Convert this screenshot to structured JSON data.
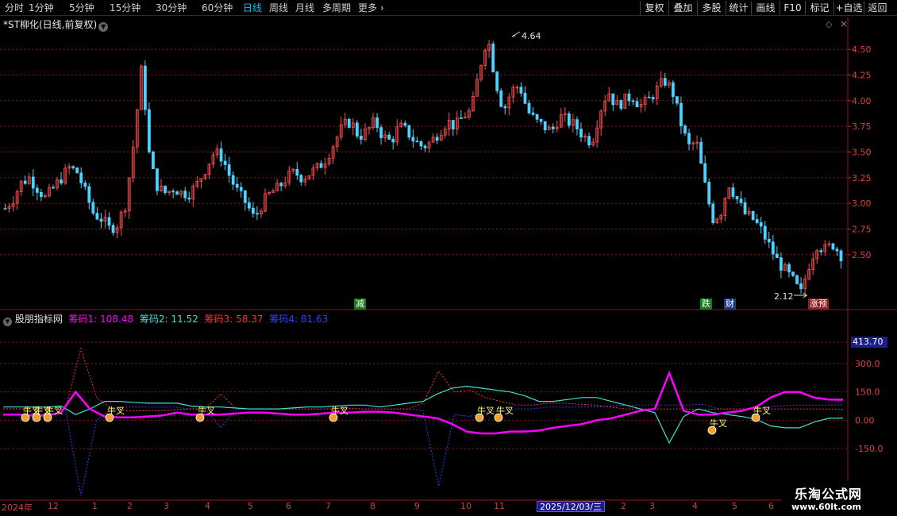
{
  "toolbar": {
    "periods": [
      "分时",
      "1分钟",
      "5分钟",
      "15分钟",
      "30分钟",
      "60分钟",
      "日线",
      "周线",
      "月线",
      "多周期",
      "更多"
    ],
    "active_period": "日线",
    "more_arrow": "›",
    "buttons": [
      "复权",
      "叠加",
      "多股",
      "统计",
      "画线",
      "F10",
      "标记",
      "+自选",
      "返回"
    ]
  },
  "stock": {
    "title": "*ST柳化(日线,前复权)",
    "high_label": "4.64",
    "low_label": "2.12"
  },
  "price_axis": {
    "ticks": [
      "4.50",
      "4.25",
      "4.00",
      "3.75",
      "3.50",
      "3.25",
      "3.00",
      "2.75",
      "2.50"
    ]
  },
  "markers": {
    "jian": "减",
    "die": "跌",
    "cai": "财",
    "zhangyu": "涨预"
  },
  "indicator": {
    "name": "股朋指标网",
    "chip1": "筹码1: 108.48",
    "chip2": "筹码2: 11.52",
    "chip3": "筹码3: 58.37",
    "chip4": "筹码4: 81.63",
    "axis_ticks": [
      "300.0",
      "150.0",
      "0.00",
      "-150.0"
    ],
    "current_value": "413.70",
    "signal_label": "牛叉"
  },
  "time_axis": {
    "year": "2024年",
    "months": [
      "12",
      "1",
      "2",
      "3",
      "4",
      "5",
      "6",
      "7",
      "8",
      "9",
      "10",
      "11",
      "2",
      "3",
      "4",
      "5",
      "6"
    ],
    "cursor_date": "2025/12/03/三"
  },
  "watermark": {
    "line1": "乐淘公式网",
    "line2": "www.60lt.com"
  },
  "colors": {
    "up": "#ff4d4d",
    "down": "#4dd2ff",
    "grid": "#8b1a1a",
    "chip1": "#ff00ff",
    "chip2": "#40e0d0",
    "chip3": "#ff3030",
    "chip4": "#3040ff",
    "active": "#00c8e6"
  },
  "chart_data": {
    "type": "candlestick",
    "title": "*ST柳化(日线,前复权)",
    "ylim": [
      2.12,
      4.64
    ],
    "y_ticks": [
      4.5,
      4.25,
      4.0,
      3.75,
      3.5,
      3.25,
      3.0,
      2.75,
      2.5
    ],
    "price_path": [
      2.95,
      3.05,
      3.2,
      3.25,
      3.15,
      3.05,
      3.15,
      3.25,
      3.35,
      3.3,
      3.1,
      2.9,
      2.85,
      2.75,
      2.8,
      3.0,
      3.6,
      4.35,
      3.4,
      3.15,
      3.1,
      3.15,
      3.1,
      3.1,
      3.2,
      3.35,
      3.5,
      3.45,
      3.25,
      3.1,
      3.0,
      2.85,
      3.0,
      3.1,
      3.15,
      3.25,
      3.3,
      3.25,
      3.3,
      3.35,
      3.45,
      3.6,
      3.75,
      3.8,
      3.65,
      3.7,
      3.8,
      3.65,
      3.6,
      3.75,
      3.7,
      3.6,
      3.55,
      3.6,
      3.7,
      3.8,
      3.75,
      3.85,
      3.9,
      4.3,
      4.64,
      4.2,
      3.9,
      4.1,
      4.15,
      3.9,
      3.8,
      3.75,
      3.7,
      3.85,
      3.8,
      3.75,
      3.65,
      3.6,
      3.9,
      4.1,
      3.95,
      4.0,
      4.05,
      3.95,
      4.0,
      4.1,
      4.2,
      4.1,
      3.8,
      3.55,
      3.6,
      3.2,
      2.85,
      2.9,
      3.2,
      3.05,
      2.9,
      2.85,
      2.75,
      2.6,
      2.45,
      2.35,
      2.25,
      2.12,
      2.4,
      2.6,
      2.55,
      2.6,
      2.5
    ],
    "indicator": {
      "series": [
        {
          "name": "筹码1",
          "last": 108.48
        },
        {
          "name": "筹码2",
          "last": 11.52
        },
        {
          "name": "筹码3",
          "last": 58.37
        },
        {
          "name": "筹码4",
          "last": 81.63
        }
      ],
      "ylim": [
        -150,
        413.7
      ],
      "chip1": [
        30,
        30,
        25,
        25,
        40,
        150,
        60,
        20,
        15,
        15,
        20,
        25,
        40,
        30,
        30,
        30,
        35,
        40,
        40,
        35,
        30,
        30,
        35,
        40,
        40,
        45,
        45,
        40,
        30,
        20,
        10,
        -20,
        -60,
        -70,
        -70,
        -60,
        -60,
        -55,
        -40,
        -30,
        -20,
        0,
        10,
        30,
        50,
        60,
        250,
        50,
        30,
        30,
        40,
        50,
        70,
        120,
        150,
        150,
        120,
        110,
        108.48
      ],
      "chip2": [
        70,
        70,
        70,
        70,
        75,
        30,
        60,
        100,
        100,
        95,
        90,
        90,
        90,
        75,
        70,
        70,
        65,
        60,
        60,
        60,
        65,
        70,
        70,
        75,
        80,
        80,
        70,
        80,
        90,
        100,
        140,
        170,
        180,
        170,
        160,
        150,
        130,
        100,
        100,
        110,
        120,
        120,
        100,
        80,
        60,
        40,
        -120,
        20,
        60,
        40,
        30,
        20,
        5,
        -30,
        -40,
        -40,
        -10,
        10,
        11.52
      ],
      "chip3": [
        60,
        60,
        60,
        60,
        60,
        380,
        120,
        60,
        50,
        50,
        50,
        55,
        60,
        60,
        140,
        60,
        60,
        60,
        60,
        60,
        60,
        60,
        65,
        60,
        60,
        60,
        60,
        90,
        260,
        150,
        160,
        120,
        100,
        80,
        80,
        90,
        90,
        85,
        80,
        70,
        60,
        60,
        60,
        60,
        60,
        55,
        60,
        60,
        60,
        60,
        60,
        60,
        60,
        60,
        58.37
      ],
      "chip4": [
        60,
        60,
        60,
        60,
        60,
        -400,
        0,
        60,
        70,
        70,
        70,
        70,
        60,
        60,
        -40,
        60,
        60,
        60,
        60,
        60,
        60,
        60,
        60,
        60,
        60,
        60,
        60,
        50,
        -350,
        30,
        20,
        40,
        50,
        60,
        60,
        70,
        70,
        70,
        70,
        75,
        80,
        80,
        80,
        80,
        80,
        85,
        60,
        60,
        60,
        70,
        75,
        80,
        80,
        80,
        81.63
      ]
    }
  }
}
